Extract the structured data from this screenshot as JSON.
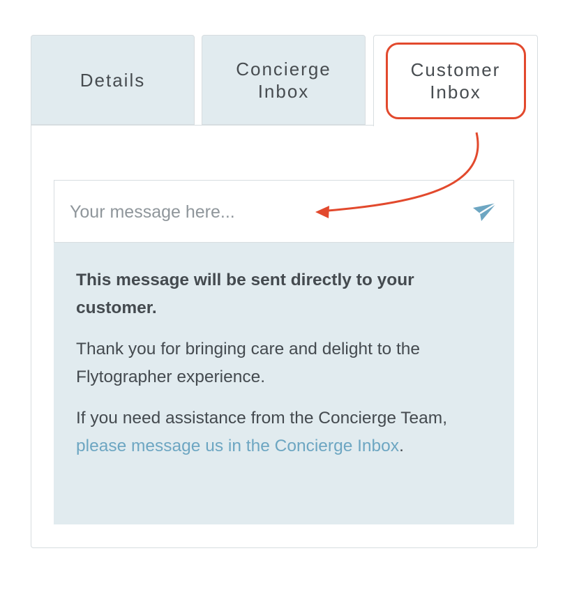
{
  "tabs": [
    {
      "label": "Details"
    },
    {
      "label": "Concierge\nInbox"
    },
    {
      "label": "Customer\nInbox"
    }
  ],
  "composer": {
    "placeholder": "Your message here...",
    "send_icon": "paper-plane-icon"
  },
  "notice": {
    "heading": "This message will be sent directly to your customer.",
    "thanks": "Thank you for bringing care and delight to the Flytographer experience.",
    "help_prefix": "If you need assistance from the Concierge Team, ",
    "help_link": "please message us in the Concierge Inbox",
    "help_suffix": "."
  },
  "colors": {
    "tab_inactive_bg": "#e1ebef",
    "notice_bg": "#e1ebef",
    "link": "#6da6c2",
    "send_icon": "#6da6c2",
    "annotation": "#e2492d"
  }
}
